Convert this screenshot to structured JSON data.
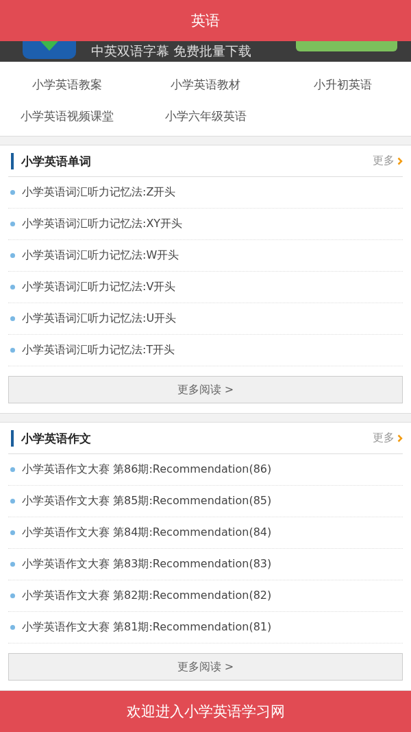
{
  "header": {
    "title": "英语"
  },
  "ad_banner": {
    "text": "中英双语字幕  免费批量下载"
  },
  "categories": [
    {
      "label": "小学英语教案"
    },
    {
      "label": "小学英语教材"
    },
    {
      "label": "小升初英语"
    },
    {
      "label": "小学英语视频课堂"
    },
    {
      "label": "小学六年级英语"
    }
  ],
  "sections": [
    {
      "title": "小学英语单词",
      "more": "更多",
      "items": [
        "小学英语词汇听力记忆法:Z开头",
        "小学英语词汇听力记忆法:XY开头",
        "小学英语词汇听力记忆法:W开头",
        "小学英语词汇听力记忆法:V开头",
        "小学英语词汇听力记忆法:U开头",
        "小学英语词汇听力记忆法:T开头"
      ],
      "button": "更多阅读 >"
    },
    {
      "title": "小学英语作文",
      "more": "更多",
      "items": [
        "小学英语作文大赛 第86期:Recommendation(86)",
        "小学英语作文大赛 第85期:Recommendation(85)",
        "小学英语作文大赛 第84期:Recommendation(84)",
        "小学英语作文大赛 第83期:Recommendation(83)",
        "小学英语作文大赛 第82期:Recommendation(82)",
        "小学英语作文大赛 第81期:Recommendation(81)"
      ],
      "button": "更多阅读 >"
    }
  ],
  "footer": {
    "text": "欢迎进入小学英语学习网"
  }
}
